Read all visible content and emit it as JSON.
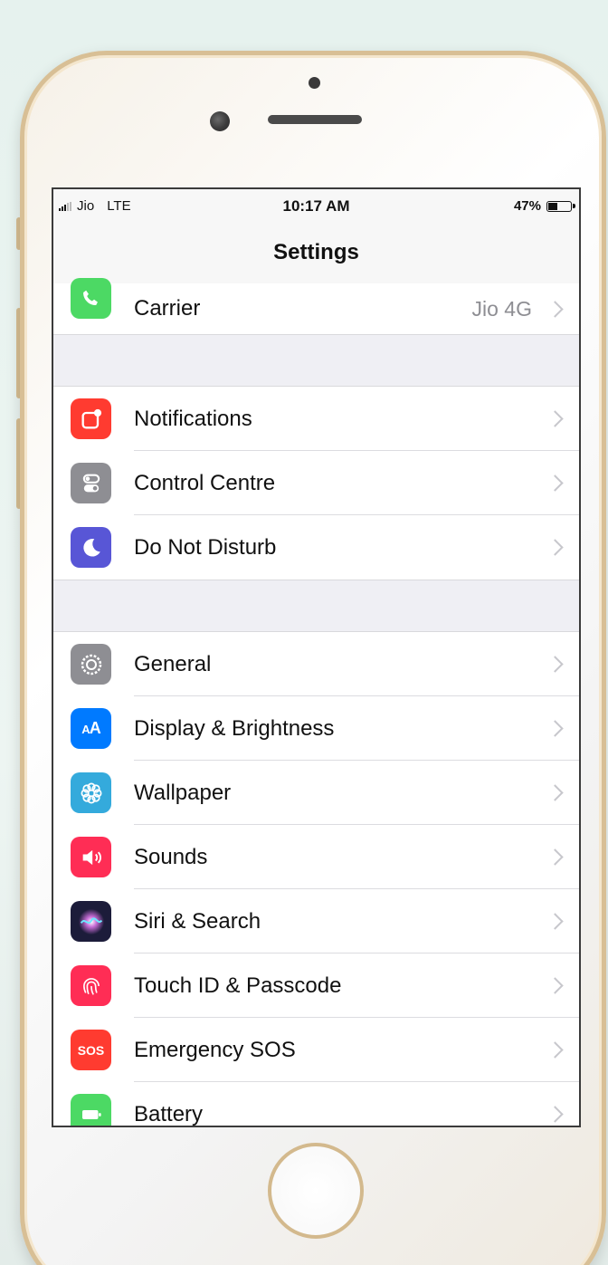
{
  "status_bar": {
    "carrier": "Jio",
    "network": "LTE",
    "time": "10:17 AM",
    "battery_percent": "47%",
    "battery_level": 0.47
  },
  "nav": {
    "title": "Settings"
  },
  "groups": [
    {
      "items": [
        {
          "label": "Carrier",
          "value": "Jio 4G",
          "icon": "phone-icon",
          "color": "#4cd964"
        }
      ]
    },
    {
      "items": [
        {
          "label": "Notifications",
          "icon": "notifications-icon",
          "color": "#ff3b30"
        },
        {
          "label": "Control Centre",
          "icon": "toggles-icon",
          "color": "#8e8e93"
        },
        {
          "label": "Do Not Disturb",
          "icon": "moon-icon",
          "color": "#5856d6"
        }
      ]
    },
    {
      "items": [
        {
          "label": "General",
          "icon": "gear-icon",
          "color": "#8e8e93"
        },
        {
          "label": "Display & Brightness",
          "icon": "text-size-icon",
          "color": "#007aff"
        },
        {
          "label": "Wallpaper",
          "icon": "flower-icon",
          "color": "#34aadc"
        },
        {
          "label": "Sounds",
          "icon": "speaker-icon",
          "color": "#ff2d55"
        },
        {
          "label": "Siri & Search",
          "icon": "siri-icon",
          "color": "#1c1c3a"
        },
        {
          "label": "Touch ID & Passcode",
          "icon": "fingerprint-icon",
          "color": "#ff2d55"
        },
        {
          "label": "Emergency SOS",
          "icon": "sos-icon",
          "icon_text": "SOS",
          "color": "#ff3b30"
        },
        {
          "label": "Battery",
          "icon": "battery-icon",
          "color": "#4cd964"
        }
      ]
    }
  ]
}
